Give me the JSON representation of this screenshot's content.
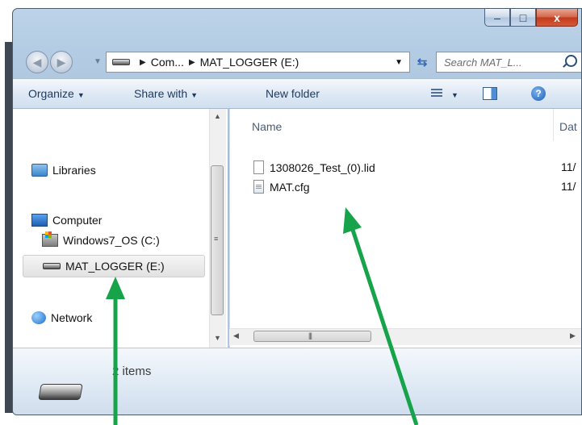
{
  "window": {
    "minimize": "–",
    "maximize": "□",
    "close": "x"
  },
  "address": {
    "crumb_1": "Com...",
    "crumb_2": "MAT_LOGGER (E:)",
    "search_placeholder": "Search MAT_L..."
  },
  "toolbar": {
    "organize": "Organize",
    "share": "Share with",
    "new_folder": "New folder"
  },
  "nav": {
    "libraries": "Libraries",
    "computer": "Computer",
    "drive_c": "Windows7_OS (C:)",
    "drive_e": "MAT_LOGGER (E:)",
    "network": "Network"
  },
  "files": {
    "col_name": "Name",
    "col_date": "Dat",
    "items": [
      {
        "name": "1308026_Test_(0).lid",
        "date": "11/"
      },
      {
        "name": "MAT.cfg",
        "date": "11/"
      }
    ]
  },
  "details": {
    "count": "2 items"
  },
  "colors": {
    "annotation": "#16a34a"
  }
}
